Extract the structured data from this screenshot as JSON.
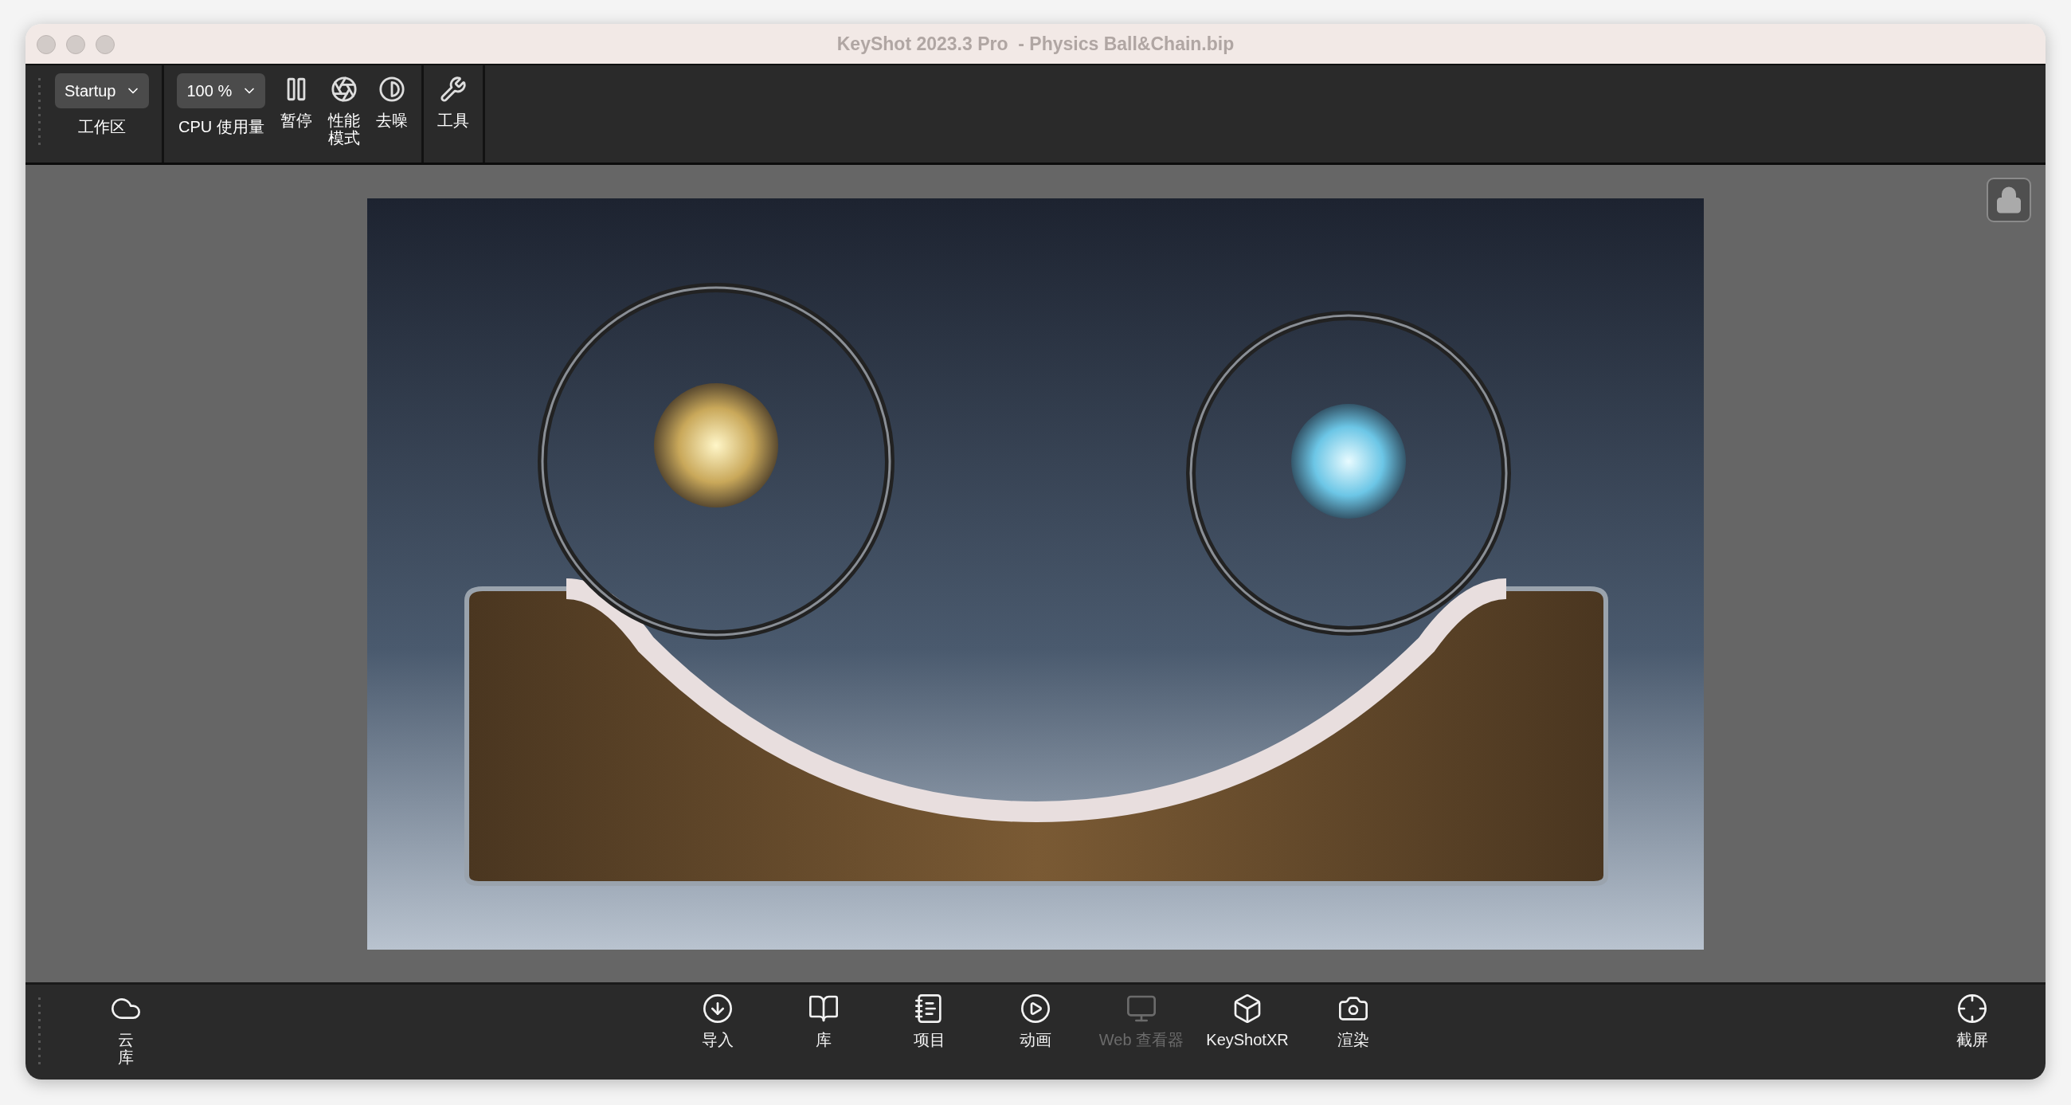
{
  "window": {
    "title": "KeyShot 2023.3 Pro  - Physics Ball&Chain.bip"
  },
  "toolbar": {
    "groups": [
      {
        "items": [
          {
            "kind": "dropdown",
            "value": "Startup",
            "label": "工作区"
          }
        ]
      },
      {
        "items": [
          {
            "kind": "dropdown",
            "value": "100 %",
            "label": "CPU 使用量"
          },
          {
            "kind": "pause",
            "label": "暂停"
          },
          {
            "kind": "performance",
            "label": "性能模式"
          },
          {
            "kind": "denoise",
            "label": "去噪"
          }
        ]
      },
      {
        "items": [
          {
            "kind": "tools",
            "label": "工具"
          }
        ]
      }
    ]
  },
  "bottom_bar": {
    "left": [
      {
        "kind": "cloud",
        "label": "云库",
        "disabled": false
      }
    ],
    "center": [
      {
        "kind": "import",
        "label": "导入",
        "disabled": false
      },
      {
        "kind": "library",
        "label": "库",
        "disabled": false
      },
      {
        "kind": "project",
        "label": "项目",
        "disabled": false
      },
      {
        "kind": "animation",
        "label": "动画",
        "disabled": false
      },
      {
        "kind": "webviewer",
        "label": "Web 查看器",
        "disabled": true
      },
      {
        "kind": "xr",
        "label": "KeyShotXR",
        "disabled": false
      },
      {
        "kind": "render",
        "label": "渲染",
        "disabled": false
      }
    ],
    "right": [
      {
        "kind": "screenshot",
        "label": "截屏",
        "disabled": false
      }
    ]
  }
}
